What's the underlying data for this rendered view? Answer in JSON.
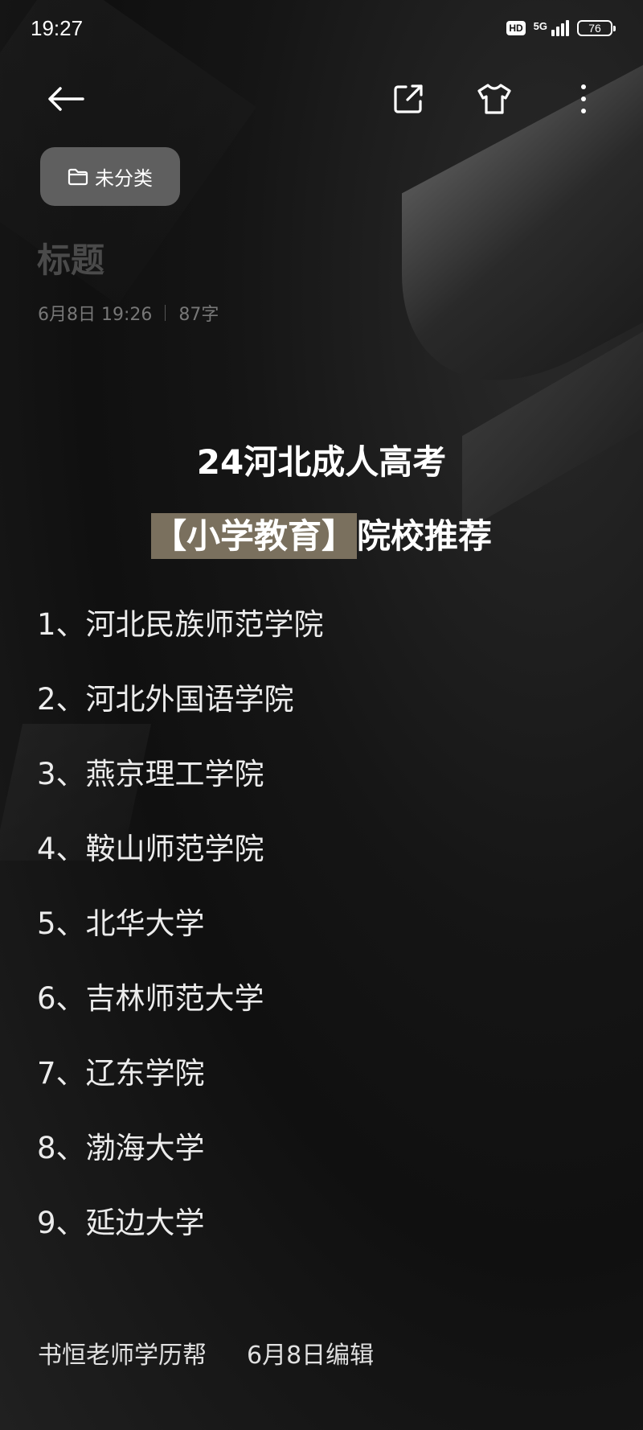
{
  "status_bar": {
    "time": "19:27",
    "hd": "HD",
    "network": "5G",
    "battery": "76"
  },
  "toolbar": {
    "back_icon": "arrow-left-icon",
    "share_icon": "external-share-icon",
    "theme_icon": "tshirt-icon",
    "more_icon": "vertical-dots-icon"
  },
  "note": {
    "category": "未分类",
    "title_placeholder": "标题",
    "date": "6月8日 19:26",
    "word_count": "87字"
  },
  "content": {
    "heading_line1": "24河北成人高考",
    "heading_line2_highlight": "【小学教育】",
    "heading_line2_rest": "院校推荐",
    "schools": [
      "1、河北民族师范学院",
      "2、河北外国语学院",
      "3、燕京理工学院",
      "4、鞍山师范学院",
      "5、北华大学",
      "6、吉林师范大学",
      "7、辽东学院",
      "8、渤海大学",
      "9、延边大学"
    ],
    "footer_author": "书恒老师学历帮",
    "footer_edit": "6月8日编辑"
  },
  "colors": {
    "background": "#1a1a1a",
    "highlight": "#7a705e",
    "chip": "#5f5f5f"
  }
}
